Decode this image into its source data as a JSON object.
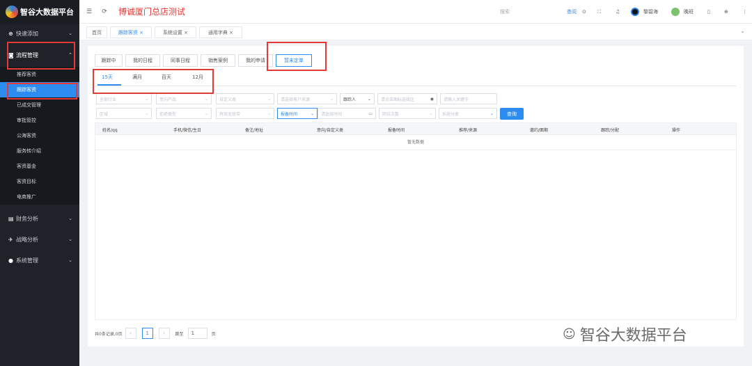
{
  "app": {
    "title": "智谷大数据平台",
    "store": "博诚厦门总店测试"
  },
  "sidebar": {
    "quick": "快速添加",
    "process": "流程管理",
    "subitems": [
      "推荐客资",
      "跟踪客资",
      "已成交管理",
      "审批管控",
      "公海客资",
      "服务转介绍",
      "客资基金",
      "客资目标",
      "电商推广"
    ],
    "finance": "财务分析",
    "strategy": "战略分析",
    "system": "系统管理"
  },
  "top": {
    "search": "搜索",
    "query": "查阅",
    "user1": "黎碧海",
    "user2": "晚班"
  },
  "pagetabs": [
    "首页",
    "跟踪客资",
    "系统设置",
    "通用字典"
  ],
  "bizTabs": [
    "跟踪中",
    "我的日程",
    "同事日程",
    "销售案例",
    "我的申请",
    "暂未定单"
  ],
  "timeTabs": [
    "15天",
    "满月",
    "百天",
    "12月"
  ],
  "filters": {
    "f1": "全部行业",
    "f2": "意向产品",
    "f3": "自定义类",
    "f4": "请选择客户来源",
    "f5": "跟踪人",
    "f6": "请点击图标选择区",
    "f7": "请输入关键字",
    "g1": "区域",
    "g2": "拒绝类型",
    "g3": "有效无效带",
    "g4": "报备时间",
    "g5": "请选择时间",
    "g6": "回访次数",
    "g7": "系统分类"
  },
  "queryBtn": "查询",
  "columns": [
    "姓名/qq",
    "手机/微信/生日",
    "备注/地址",
    "意向/自定义类",
    "报备时间",
    "推荐/来源",
    "邀约/面期",
    "跟踪/分配",
    "操作"
  ],
  "empty": "暂无数据",
  "pager": {
    "total": "共0条记录,0页",
    "page": "1",
    "goto": "跳至",
    "input": "1",
    "unit": "页"
  },
  "watermark": "智谷大数据平台"
}
